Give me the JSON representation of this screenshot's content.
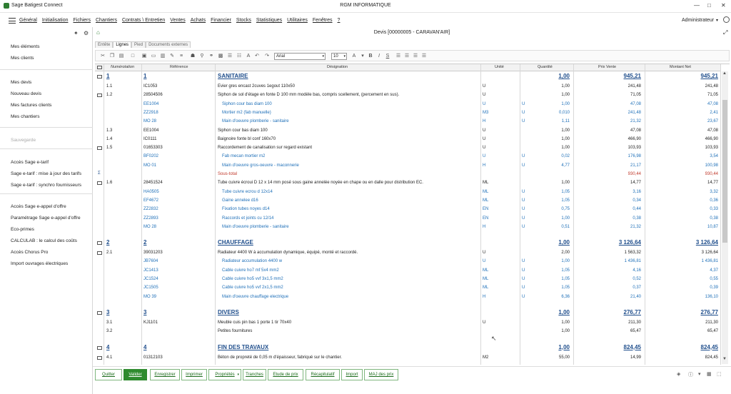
{
  "window": {
    "app_title": "Sage Batigest Connect",
    "company": "RGM INFORMATIQUE",
    "controls": [
      "—",
      "□",
      "✕"
    ]
  },
  "menu": {
    "items": [
      "Général",
      "Initialisation",
      "Fichiers",
      "Chantiers",
      "Contrats \\ Entretien",
      "Ventes",
      "Achats",
      "Financier",
      "Stocks",
      "Statistiques",
      "Utilitaires",
      "Fenêtres",
      "?"
    ],
    "user": "Administrateur"
  },
  "sidebar": {
    "groups": [
      [
        "Mes éléments",
        "Mes clients"
      ],
      [
        "Mes devis",
        "Nouveau devis",
        "Mes factures clients",
        "Mes chantiers"
      ],
      [
        "Sauvegarde"
      ],
      [
        "Accès Sage e-tarif",
        "Sage e-tarif : mise à jour des tarifs",
        "Sage e-tarif : synchro fournisseurs"
      ],
      [
        "Accès Sage e-appel d'offre",
        "Paramétrage Sage e-appel d'offre",
        "Eco-primes",
        "CALCULAB : le calcul des coûts",
        "Accès Chorus Pro",
        "Import ouvrages électriques"
      ]
    ]
  },
  "document": {
    "title": "Devis [00000005 - CARAVAN'AIR]",
    "tabs": [
      "Entête",
      "Lignes",
      "Pied",
      "Documents externes"
    ],
    "active_tab": "Lignes",
    "font_name": "Arial",
    "font_size": "10"
  },
  "grid": {
    "headers": {
      "numerotation": "Numérotation",
      "reference": "Référence",
      "designation": "Désignation",
      "unite": "Unité",
      "quantite": "Quantité",
      "prix_vente": "Prix Vente",
      "montant_net": "Montant Net"
    },
    "rows": [
      {
        "kind": "title",
        "num": "1",
        "ref": "1",
        "des": "SANITAIRE",
        "qty": "1,00",
        "pv": "945,21",
        "mn": "945,21"
      },
      {
        "kind": "line",
        "num": "1.1",
        "ref": "IC1053",
        "des": "Evier gres encast 2cuves 1egout 110x50",
        "u": "U",
        "u2": "",
        "qty": "1,00",
        "pv": "241,48",
        "mn": "241,48"
      },
      {
        "kind": "line",
        "folder": true,
        "num": "1.2",
        "ref": "28504506",
        "des": "Siphon de sol d'étage en fonte D 100 mm modèle bas, compris scellement, (percement en sus).",
        "u": "U",
        "u2": "",
        "qty": "1,00",
        "pv": "71,05",
        "mn": "71,05"
      },
      {
        "kind": "sub",
        "num": "",
        "ref": "EE1004",
        "des": "Siphon cour bas diam 100",
        "u": "U",
        "u2": "U",
        "qty": "1,00",
        "pv": "47,08",
        "mn": "47,08"
      },
      {
        "kind": "sub",
        "num": "",
        "ref": "ZZ2918",
        "des": "Mortier m2 (fab manuelle)",
        "u": "M3",
        "u2": "U",
        "qty": "0,010",
        "pv": "241,48",
        "mn": "2,41"
      },
      {
        "kind": "sub",
        "num": "",
        "ref": "MO 28",
        "des": "Main d'oeuvre plomberie - sanitaire",
        "u": "H",
        "u2": "U",
        "qty": "1,11",
        "pv": "21,32",
        "mn": "23,67"
      },
      {
        "kind": "line",
        "num": "1.3",
        "ref": "EE1004",
        "des": "Siphon cour bas diam 100",
        "u": "U",
        "u2": "",
        "qty": "1,00",
        "pv": "47,08",
        "mn": "47,08"
      },
      {
        "kind": "line",
        "num": "1.4",
        "ref": "IC0111",
        "des": "Baignoire fonte bl conf 160x70",
        "u": "U",
        "u2": "",
        "qty": "1,00",
        "pv": "466,90",
        "mn": "466,90"
      },
      {
        "kind": "line",
        "folder": true,
        "num": "1.5",
        "ref": "01653303",
        "des": "Raccordement de canalisation sur regard existant",
        "u": "U",
        "u2": "",
        "qty": "1,00",
        "pv": "103,93",
        "mn": "103,93"
      },
      {
        "kind": "sub",
        "num": "",
        "ref": "BF0202",
        "des": "Fab mecan mortier m2",
        "u": "U",
        "u2": "U",
        "qty": "0,02",
        "pv": "176,98",
        "mn": "3,54"
      },
      {
        "kind": "sub",
        "num": "",
        "ref": "MO 01",
        "des": "Main d'oeuvre gros-oeuvre - maconnerie",
        "u": "H",
        "u2": "U",
        "qty": "4,77",
        "pv": "21,17",
        "mn": "100,98"
      },
      {
        "kind": "subtotal",
        "num": "",
        "ref": "",
        "des": "Sous-total",
        "u": "",
        "u2": "",
        "qty": "",
        "pv": "930,44",
        "mn": "930,44"
      },
      {
        "kind": "line",
        "folder": true,
        "num": "1.6",
        "ref": "28451524",
        "des": "Tube cuivre écroui D 12 x 14 mm posé sous gaine annelée noyée en chape ou en dalle pour distribution EC.",
        "u": "ML",
        "u2": "",
        "qty": "1,00",
        "pv": "14,77",
        "mn": "14,77"
      },
      {
        "kind": "sub",
        "num": "",
        "ref": "HA0505",
        "des": "Tube cuivre ecrou d 12x14",
        "u": "ML",
        "u2": "U",
        "qty": "1,05",
        "pv": "3,16",
        "mn": "3,32"
      },
      {
        "kind": "sub",
        "num": "",
        "ref": "EF4672",
        "des": "Gaine annelee d16",
        "u": "ML",
        "u2": "U",
        "qty": "1,05",
        "pv": "0,34",
        "mn": "0,36"
      },
      {
        "kind": "sub",
        "num": "",
        "ref": "ZZ2832",
        "des": "Fixation tubes noyes d14",
        "u": "EN",
        "u2": "U",
        "qty": "0,75",
        "pv": "0,44",
        "mn": "0,33"
      },
      {
        "kind": "sub",
        "num": "",
        "ref": "ZZ2893",
        "des": "Raccords et joints cu 12/14",
        "u": "EN",
        "u2": "U",
        "qty": "1,00",
        "pv": "0,38",
        "mn": "0,38"
      },
      {
        "kind": "sub",
        "num": "",
        "ref": "MO 28",
        "des": "Main d'oeuvre plomberie - sanitaire",
        "u": "H",
        "u2": "U",
        "qty": "0,51",
        "pv": "21,32",
        "mn": "10,87"
      },
      {
        "kind": "blank"
      },
      {
        "kind": "title",
        "num": "2",
        "ref": "2",
        "des": "CHAUFFAGE",
        "qty": "1,00",
        "pv": "3 126,64",
        "mn": "3 126,64"
      },
      {
        "kind": "line",
        "folder": true,
        "num": "2.1",
        "ref": "39031203",
        "des": "Radiateur 4400 W à accumulation dynamique, équipé, monté et raccordé.",
        "u": "U",
        "u2": "",
        "qty": "2,00",
        "pv": "1 563,32",
        "mn": "3 126,64"
      },
      {
        "kind": "sub",
        "num": "",
        "ref": "JB7604",
        "des": "Radiateur accumulation 4400 w",
        "u": "U",
        "u2": "U",
        "qty": "1,00",
        "pv": "1 436,81",
        "mn": "1 436,81"
      },
      {
        "kind": "sub",
        "num": "",
        "ref": "JC1413",
        "des": "Cable cuivre ho7 mf 5x4 mm2",
        "u": "ML",
        "u2": "U",
        "qty": "1,05",
        "pv": "4,16",
        "mn": "4,37"
      },
      {
        "kind": "sub",
        "num": "",
        "ref": "JC1524",
        "des": "Cable cuivre ho5 vvf 3x1,5 mm2",
        "u": "ML",
        "u2": "U",
        "qty": "1,05",
        "pv": "0,52",
        "mn": "0,55"
      },
      {
        "kind": "sub",
        "num": "",
        "ref": "JC1505",
        "des": "Cable cuivre ho5 vvf 2x1,5 mm2",
        "u": "ML",
        "u2": "U",
        "qty": "1,05",
        "pv": "0,37",
        "mn": "0,39"
      },
      {
        "kind": "sub",
        "num": "",
        "ref": "MO 39",
        "des": "Main d'oeuvre chauffage electrique",
        "u": "H",
        "u2": "U",
        "qty": "6,36",
        "pv": "21,40",
        "mn": "136,10"
      },
      {
        "kind": "blank"
      },
      {
        "kind": "title",
        "num": "3",
        "ref": "3",
        "des": "DIVERS",
        "qty": "1,00",
        "pv": "276,77",
        "mn": "276,77"
      },
      {
        "kind": "line",
        "num": "3.1",
        "ref": "KJ1101",
        "des": "Meuble cuis pin bas 1 porte 1 tir 70x40",
        "u": "U",
        "u2": "",
        "qty": "1,00",
        "pv": "211,30",
        "mn": "211,30"
      },
      {
        "kind": "line",
        "num": "3.2",
        "ref": "",
        "des": "Petites fournitures",
        "u": "",
        "u2": "",
        "qty": "1,00",
        "pv": "65,47",
        "mn": "65,47"
      },
      {
        "kind": "blank"
      },
      {
        "kind": "title",
        "num": "4",
        "ref": "4",
        "des": "FIN DES TRAVAUX",
        "qty": "1,00",
        "pv": "824,45",
        "mn": "824,45"
      },
      {
        "kind": "line",
        "folder": true,
        "num": "4.1",
        "ref": "01312103",
        "des": "Béton de propreté de 0,05 m d'épaisseur, fabriqué sur le chantier.",
        "u": "M2",
        "u2": "",
        "qty": "55,00",
        "pv": "14,99",
        "mn": "824,45"
      }
    ]
  },
  "buttons": [
    "Quitter",
    "Valider",
    "Enregistrer",
    "Imprimer",
    "Propriétés",
    "Tranches",
    "Etude de prix",
    "Récapitulatif",
    "Import",
    "MAJ des prix"
  ],
  "icons": {
    "sidebar_pin": "pin-icon",
    "sidebar_settings": "gear-icon",
    "document_home": "home-icon"
  },
  "colors": {
    "brand_green": "#2e8b2e",
    "title_blue": "#1f4e8c",
    "sub_line_blue": "#1e6fb8",
    "subtotal_red": "#c0392b"
  }
}
